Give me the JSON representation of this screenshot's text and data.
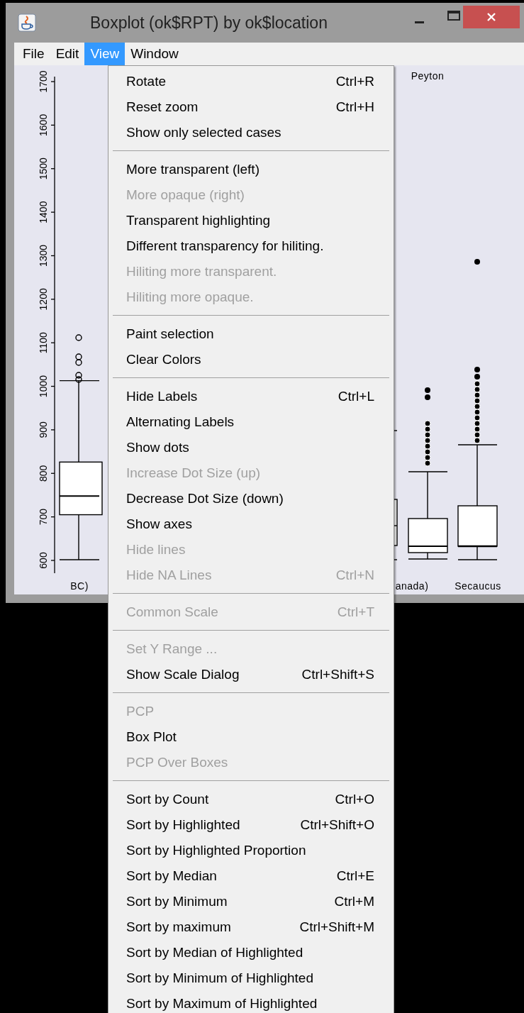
{
  "window": {
    "title": "Boxplot (ok$RPT) by ok$location"
  },
  "menubar": [
    {
      "label": "File",
      "selected": false
    },
    {
      "label": "Edit",
      "selected": false
    },
    {
      "label": "View",
      "selected": true
    },
    {
      "label": "Window",
      "selected": false
    }
  ],
  "plot": {
    "y_ticks": [
      "600",
      "700",
      "800",
      "900",
      "1000",
      "1100",
      "1200",
      "1300",
      "1400",
      "1500",
      "1600",
      "1700"
    ],
    "top_label": "Peyton",
    "category_labels": [
      "BC)",
      "anada)",
      "Secaucus"
    ]
  },
  "menu": {
    "groups": [
      {
        "items": [
          {
            "label": "Rotate",
            "shortcut": "Ctrl+R",
            "disabled": false
          },
          {
            "label": "Reset zoom",
            "shortcut": "Ctrl+H",
            "disabled": false
          },
          {
            "label": "Show only selected cases",
            "disabled": false
          }
        ]
      },
      {
        "items": [
          {
            "label": "More transparent (left)",
            "disabled": false
          },
          {
            "label": "More opaque (right)",
            "disabled": true
          },
          {
            "label": "Transparent highlighting",
            "disabled": false
          },
          {
            "label": "Different transparency for hiliting.",
            "disabled": false
          },
          {
            "label": "Hiliting more transparent.",
            "disabled": true
          },
          {
            "label": "Hiliting more opaque.",
            "disabled": true
          }
        ]
      },
      {
        "items": [
          {
            "label": "Paint selection",
            "disabled": false
          },
          {
            "label": "Clear Colors",
            "disabled": false
          }
        ]
      },
      {
        "items": [
          {
            "label": "Hide Labels",
            "shortcut": "Ctrl+L",
            "disabled": false
          },
          {
            "label": "Alternating Labels",
            "disabled": false
          },
          {
            "label": "Show dots",
            "disabled": false
          },
          {
            "label": "Increase Dot Size (up)",
            "disabled": true
          },
          {
            "label": "Decrease Dot Size (down)",
            "disabled": false
          },
          {
            "label": "Show axes",
            "disabled": false
          },
          {
            "label": "Hide lines",
            "disabled": true
          },
          {
            "label": "Hide NA Lines",
            "shortcut": "Ctrl+N",
            "disabled": true
          }
        ]
      },
      {
        "items": [
          {
            "label": "Common Scale",
            "shortcut": "Ctrl+T",
            "disabled": true
          }
        ]
      },
      {
        "items": [
          {
            "label": "Set Y Range ...",
            "disabled": true
          },
          {
            "label": "Show Scale Dialog",
            "shortcut": "Ctrl+Shift+S",
            "disabled": false
          }
        ]
      },
      {
        "items": [
          {
            "label": "PCP",
            "disabled": true
          },
          {
            "label": "Box Plot",
            "disabled": false
          },
          {
            "label": "PCP Over Boxes",
            "disabled": true
          }
        ]
      },
      {
        "items": [
          {
            "label": "Sort by Count",
            "shortcut": "Ctrl+O",
            "disabled": false
          },
          {
            "label": "Sort by Highlighted",
            "shortcut": "Ctrl+Shift+O",
            "disabled": false
          },
          {
            "label": "Sort by Highlighted Proportion",
            "disabled": false
          },
          {
            "label": "Sort by Median",
            "shortcut": "Ctrl+E",
            "disabled": false
          },
          {
            "label": "Sort by Minimum",
            "shortcut": "Ctrl+M",
            "disabled": false
          },
          {
            "label": "Sort by maximum",
            "shortcut": "Ctrl+Shift+M",
            "disabled": false
          },
          {
            "label": "Sort by Median of Highlighted",
            "disabled": false
          },
          {
            "label": "Sort by Minimum of Highlighted",
            "disabled": false
          },
          {
            "label": "Sort by Maximum of Highlighted",
            "disabled": false
          }
        ]
      }
    ]
  }
}
